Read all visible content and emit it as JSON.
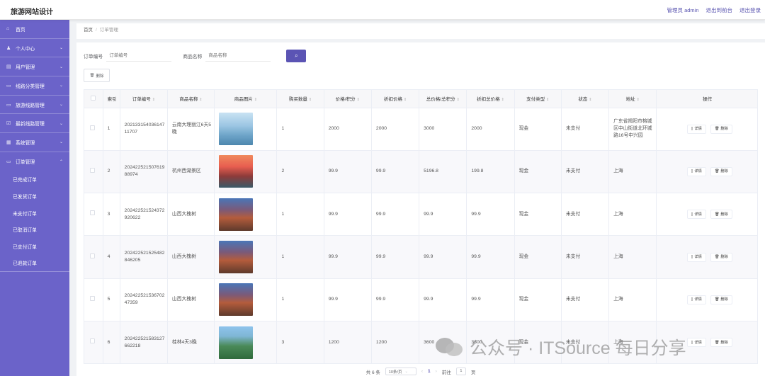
{
  "header": {
    "brand": "旅游网站设计",
    "admin_label": "管理员 admin",
    "front_link": "退出到前台",
    "logout_link": "退出登录"
  },
  "sidebar": {
    "items": [
      {
        "label": "首页",
        "icon": "home-icon"
      },
      {
        "label": "个人中心",
        "icon": "user-icon"
      },
      {
        "label": "用户管理",
        "icon": "users-icon"
      },
      {
        "label": "线路分类管理",
        "icon": "category-icon"
      },
      {
        "label": "旅游线路管理",
        "icon": "route-icon"
      },
      {
        "label": "最新线路管理",
        "icon": "new-icon"
      },
      {
        "label": "系统管理",
        "icon": "system-icon"
      },
      {
        "label": "订单管理",
        "icon": "order-icon"
      }
    ],
    "sub_items": [
      "已完成订单",
      "已发货订单",
      "未支付订单",
      "已取消订单",
      "已支付订单",
      "已退款订单"
    ]
  },
  "breadcrumb": {
    "home": "首页",
    "separator": "/",
    "current": "订单管理"
  },
  "search": {
    "order_label": "订单编号",
    "order_placeholder": "订单编号",
    "product_label": "商品名称",
    "product_placeholder": "商品名称",
    "search_icon": "⌕"
  },
  "toolbar": {
    "delete_label": "删除"
  },
  "table": {
    "headers": [
      "索引",
      "订单编号",
      "商品名称",
      "商品图片",
      "购买数量",
      "价格/积分",
      "折扣价格",
      "总价格/总积分",
      "折扣总价格",
      "支付类型",
      "状态",
      "地址",
      "操作"
    ],
    "detail_label": "详情",
    "delete_label": "删除",
    "rows": [
      {
        "index": "1",
        "order_no": "202133154036147 11707",
        "product": "云南大理丽江6天5晚",
        "qty": "1",
        "price": "2000",
        "discount": "2000",
        "total": "3000",
        "discount_total": "2000",
        "pay_type": "现金",
        "status": "未支付",
        "address": "广东省揭阳市榕城区中山街道北环城路16号中兴园"
      },
      {
        "index": "2",
        "order_no": "20242252150761988974",
        "product": "杭州西湖景区",
        "qty": "2",
        "price": "99.9",
        "discount": "99.9",
        "total": "5196.8",
        "discount_total": "199.8",
        "pay_type": "现金",
        "status": "未支付",
        "address": "上海"
      },
      {
        "index": "3",
        "order_no": "202422521524372920622",
        "product": "山西大槐树",
        "qty": "1",
        "price": "99.9",
        "discount": "99.9",
        "total": "99.9",
        "discount_total": "99.9",
        "pay_type": "现金",
        "status": "未支付",
        "address": "上海"
      },
      {
        "index": "4",
        "order_no": "202422521525482846205",
        "product": "山西大槐树",
        "qty": "1",
        "price": "99.9",
        "discount": "99.9",
        "total": "99.9",
        "discount_total": "99.9",
        "pay_type": "现金",
        "status": "未支付",
        "address": "上海"
      },
      {
        "index": "5",
        "order_no": "20242252153670247359",
        "product": "山西大槐树",
        "qty": "1",
        "price": "99.9",
        "discount": "99.9",
        "total": "99.9",
        "discount_total": "99.9",
        "pay_type": "现金",
        "status": "未支付",
        "address": "上海"
      },
      {
        "index": "6",
        "order_no": "202422521583127662218",
        "product": "桂林4天3晚",
        "qty": "3",
        "price": "1200",
        "discount": "1200",
        "total": "3600",
        "discount_total": "3600",
        "pay_type": "现金",
        "status": "未支付",
        "address": "上海"
      }
    ]
  },
  "pagination": {
    "total_text": "共 6 条",
    "page_size": "10条/页",
    "current_page": "1",
    "goto_label": "前往",
    "goto_value": "1",
    "page_suffix": "页"
  },
  "watermark": {
    "text": "公众号 · ITSource 每日分享"
  },
  "colors": {
    "sidebar": "#6b63c9",
    "accent": "#5b54b4"
  }
}
